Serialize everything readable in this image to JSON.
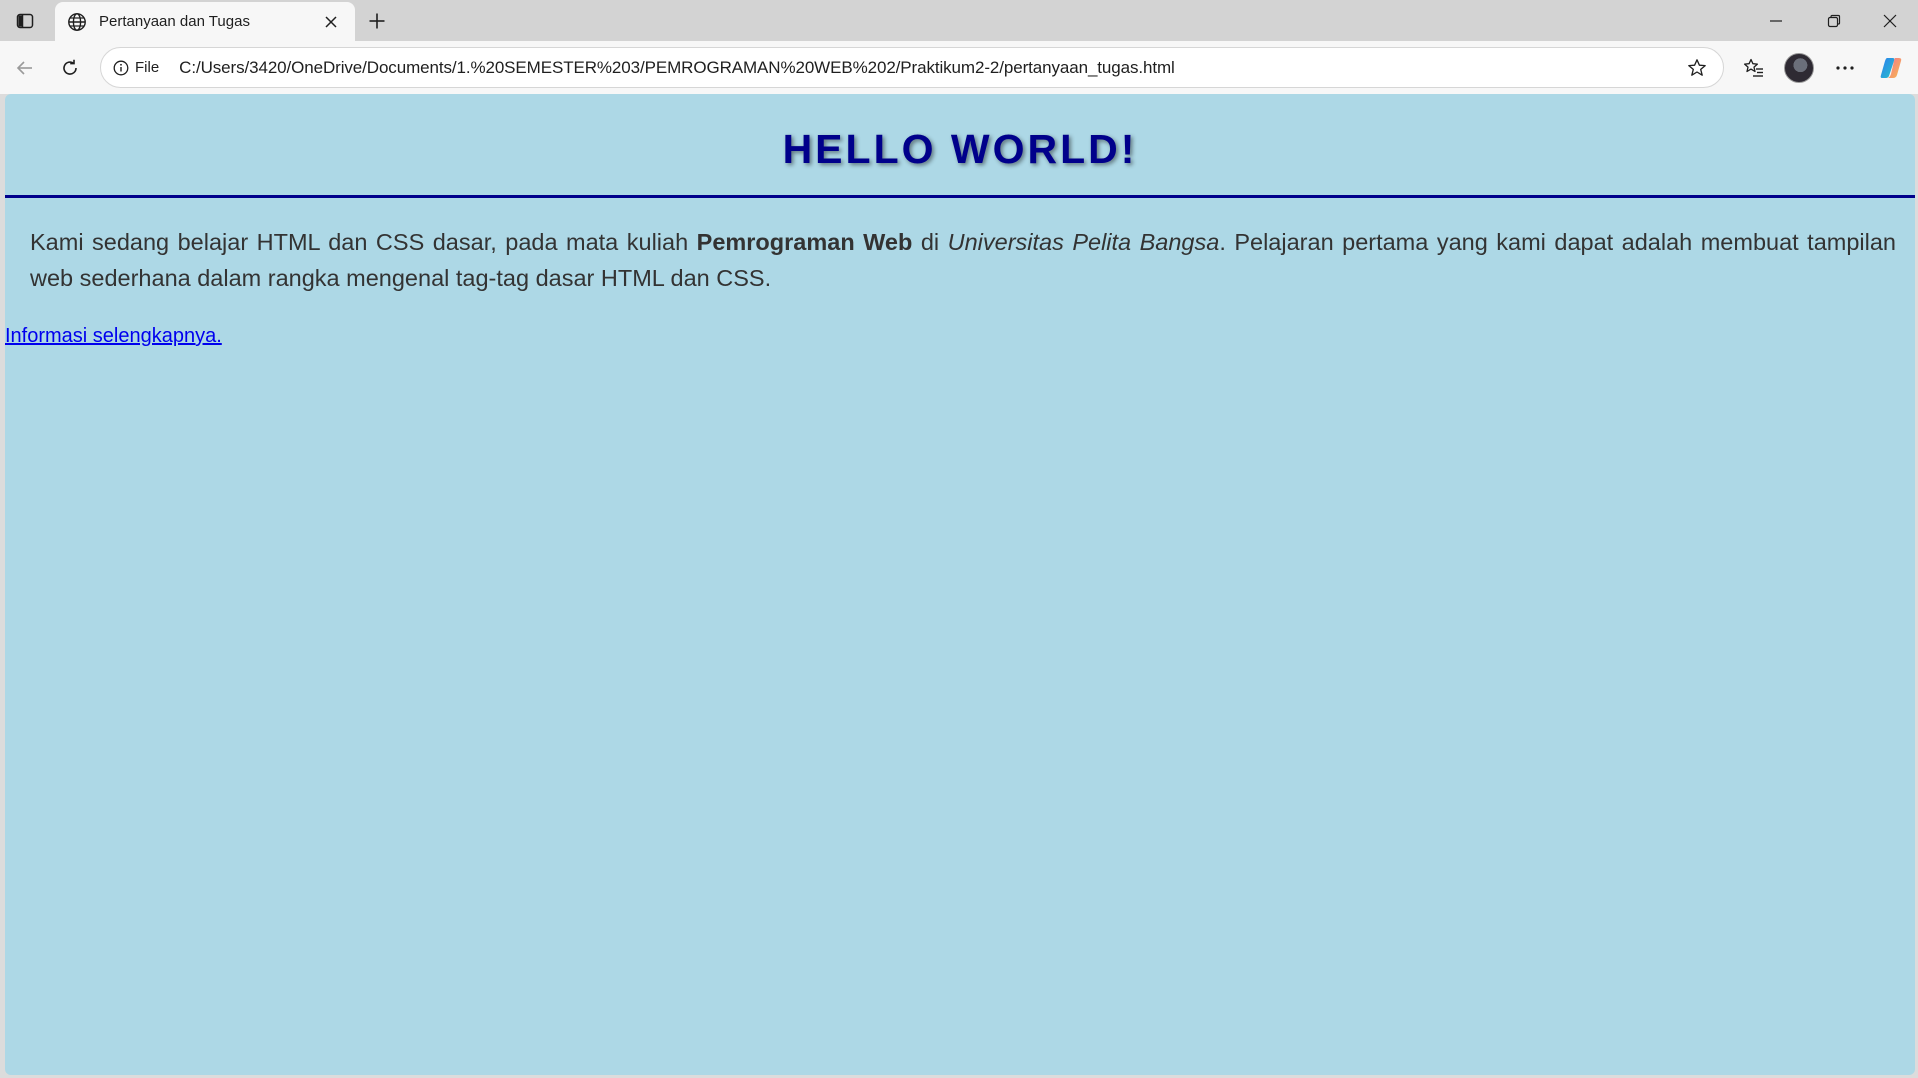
{
  "browser": {
    "tab": {
      "title": "Pertanyaan dan Tugas"
    },
    "address_bar": {
      "site_info_label": "File",
      "url": "C:/Users/3420/OneDrive/Documents/1.%20SEMESTER%203/PEMROGRAMAN%20WEB%202/Praktikum2-2/pertanyaan_tugas.html"
    },
    "colors": {
      "tabstrip": "#d3d3d3",
      "toolbar": "#f7f7f7"
    }
  },
  "page": {
    "background": "lightblue",
    "heading": "HELLO WORLD!",
    "paragraph": {
      "intro": "Kami sedang belajar HTML dan CSS dasar, pada mata kuliah ",
      "bold": "Pemrograman Web",
      "mid": " di ",
      "italic": "Universitas Pelita Bangsa",
      "outro": ". Pelajaran pertama yang kami dapat adalah membuat tampilan web sederhana dalam rangka mengenal tag-tag dasar HTML dan CSS."
    },
    "link_text": "Informasi selengkapnya."
  }
}
